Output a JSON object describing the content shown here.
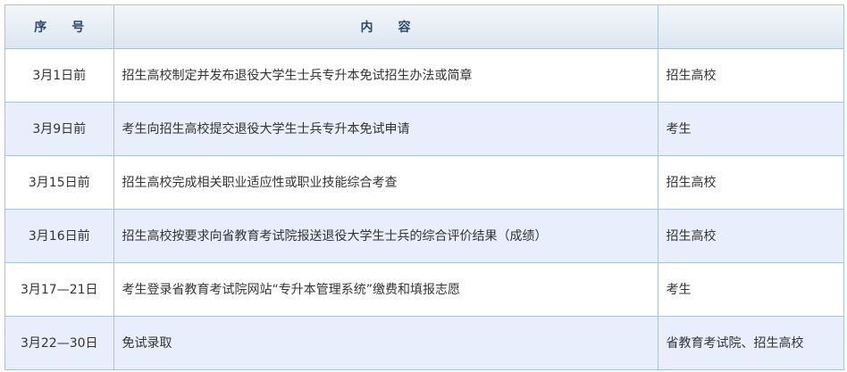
{
  "table": {
    "headers": [
      "序　　号",
      "内　　容",
      ""
    ],
    "rows": [
      {
        "date": "3月1日前",
        "content": "招生高校制定并发布退役大学生士兵专升本免试招生办法或简章",
        "party": "招生高校"
      },
      {
        "date": "3月9日前",
        "content": "考生向招生高校提交退役大学生士兵专升本免试申请",
        "party": "考生"
      },
      {
        "date": "3月15日前",
        "content": "招生高校完成相关职业适应性或职业技能综合考查",
        "party": "招生高校"
      },
      {
        "date": "3月16日前",
        "content": "招生高校按要求向省教育考试院报送退役大学生士兵的综合评价结果（成绩）",
        "party": "招生高校"
      },
      {
        "date": "3月17—21日",
        "content": "考生登录省教育考试院网站“专升本管理系统”缴费和填报志愿",
        "party": "考生"
      },
      {
        "date": "3月22—30日",
        "content": "免试录取",
        "party": "省教育考试院、招生高校"
      }
    ]
  },
  "colors": {
    "border": "#a9c3dd",
    "header_text": "#2b4a6b",
    "stripe": "#e8eefb"
  }
}
